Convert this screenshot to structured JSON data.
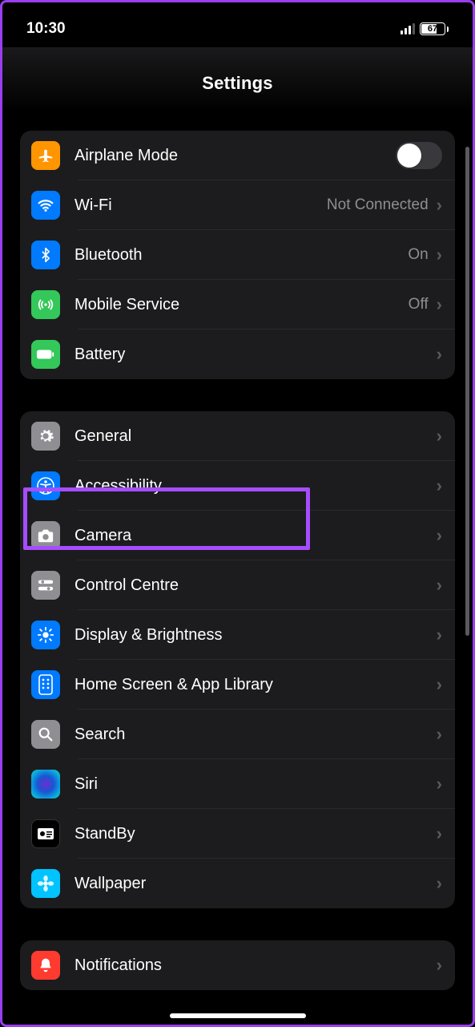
{
  "status": {
    "time": "10:30",
    "battery": "67"
  },
  "header": {
    "title": "Settings"
  },
  "groups": [
    {
      "rows": [
        {
          "id": "airplane",
          "icon": "airplane-icon",
          "icon_bg": "bg-orange",
          "label": "Airplane Mode",
          "control": "toggle",
          "toggle_on": false
        },
        {
          "id": "wifi",
          "icon": "wifi-icon",
          "icon_bg": "bg-blue",
          "label": "Wi-Fi",
          "value": "Not Connected",
          "chevron": true
        },
        {
          "id": "bluetooth",
          "icon": "bluetooth-icon",
          "icon_bg": "bg-blue",
          "label": "Bluetooth",
          "value": "On",
          "chevron": true
        },
        {
          "id": "mobile",
          "icon": "antenna-icon",
          "icon_bg": "bg-green",
          "label": "Mobile Service",
          "value": "Off",
          "chevron": true
        },
        {
          "id": "battery",
          "icon": "battery-icon",
          "icon_bg": "bg-green",
          "label": "Battery",
          "chevron": true
        }
      ]
    },
    {
      "rows": [
        {
          "id": "general",
          "icon": "gear-icon",
          "icon_bg": "bg-gray",
          "label": "General",
          "chevron": true
        },
        {
          "id": "accessibility",
          "icon": "accessibility-icon",
          "icon_bg": "bg-blue",
          "label": "Accessibility",
          "chevron": true,
          "highlighted": true
        },
        {
          "id": "camera",
          "icon": "camera-icon",
          "icon_bg": "bg-gray",
          "label": "Camera",
          "chevron": true
        },
        {
          "id": "control-centre",
          "icon": "sliders-icon",
          "icon_bg": "bg-gray",
          "label": "Control Centre",
          "chevron": true
        },
        {
          "id": "display",
          "icon": "brightness-icon",
          "icon_bg": "bg-blue",
          "label": "Display & Brightness",
          "chevron": true
        },
        {
          "id": "home-screen",
          "icon": "phone-grid-icon",
          "icon_bg": "bg-blue",
          "label": "Home Screen & App Library",
          "chevron": true
        },
        {
          "id": "search",
          "icon": "search-icon",
          "icon_bg": "bg-gray",
          "label": "Search",
          "chevron": true
        },
        {
          "id": "siri",
          "icon": "siri-icon",
          "icon_bg": "bg-siri",
          "label": "Siri",
          "chevron": true
        },
        {
          "id": "standby",
          "icon": "standby-icon",
          "icon_bg": "bg-black",
          "label": "StandBy",
          "chevron": true
        },
        {
          "id": "wallpaper",
          "icon": "wallpaper-icon",
          "icon_bg": "bg-cyan",
          "label": "Wallpaper",
          "chevron": true
        }
      ]
    },
    {
      "rows": [
        {
          "id": "notifications",
          "icon": "bell-icon",
          "icon_bg": "bg-red",
          "label": "Notifications",
          "chevron": true
        }
      ]
    }
  ]
}
